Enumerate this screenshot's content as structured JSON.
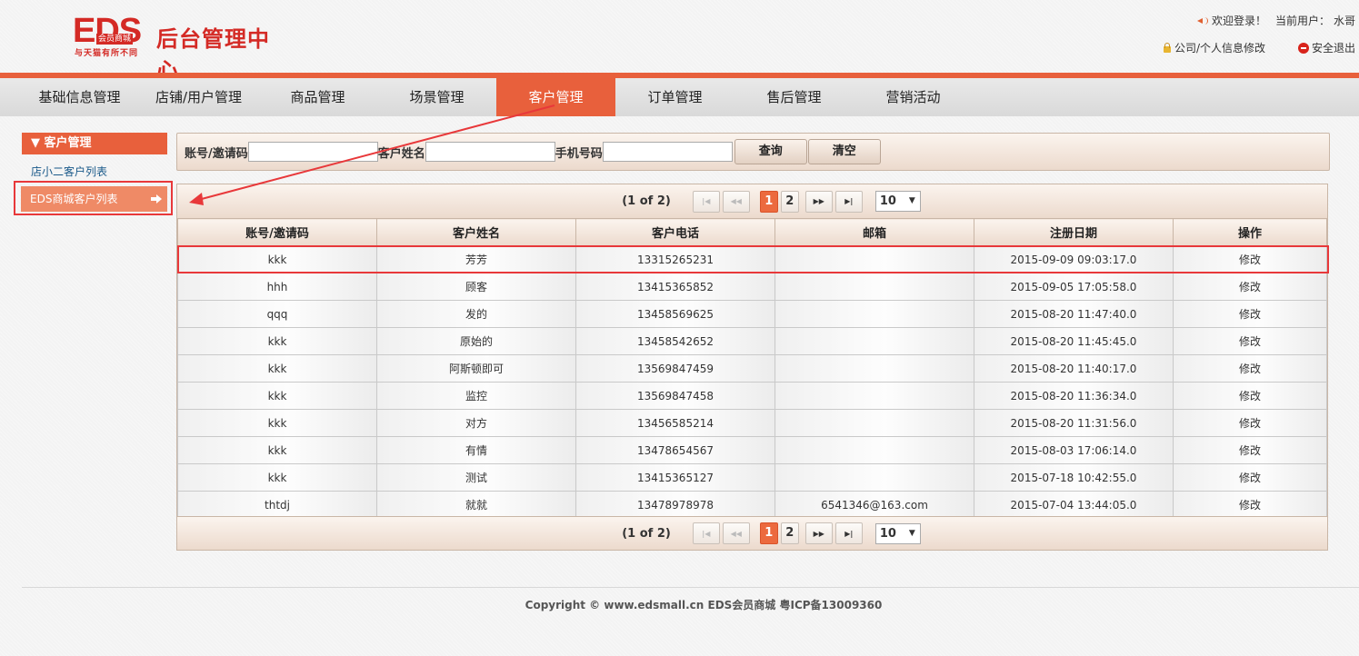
{
  "logo": {
    "eds": "EDS",
    "badge": "会员商城",
    "slogan": "与天猫有所不同",
    "title": "后台管理中心"
  },
  "topbar": {
    "welcome": "欢迎登录！",
    "current_user_label": "当前用户：",
    "current_user": "水哥",
    "profile_link": "公司/个人信息修改",
    "logout_link": "安全退出"
  },
  "nav": {
    "items": [
      {
        "label": "基础信息管理"
      },
      {
        "label": "店铺/用户管理"
      },
      {
        "label": "商品管理"
      },
      {
        "label": "场景管理"
      },
      {
        "label": "客户管理"
      },
      {
        "label": "订单管理"
      },
      {
        "label": "售后管理"
      },
      {
        "label": "营销活动"
      }
    ],
    "active_index": 4
  },
  "sidebar": {
    "header": "▼ 客户管理",
    "link_1": "店小二客户列表",
    "link_active": "EDS商城客户列表"
  },
  "search": {
    "account_label": "账号/邀请码",
    "name_label": "客户姓名",
    "phone_label": "手机号码",
    "account_value": "",
    "name_value": "",
    "phone_value": "",
    "query_btn": "查询",
    "clear_btn": "清空"
  },
  "pager": {
    "info": "(1 of 2)",
    "first": "|◀",
    "prev": "◀◀",
    "pages": [
      "1",
      "2"
    ],
    "current": "1",
    "next": "▶▶",
    "last": "▶|",
    "page_size": "10"
  },
  "table": {
    "columns": [
      "账号/邀请码",
      "客户姓名",
      "客户电话",
      "邮箱",
      "注册日期",
      "操作"
    ],
    "rows": [
      [
        "kkk",
        "芳芳",
        "13315265231",
        "",
        "2015-09-09 09:03:17.0",
        "修改"
      ],
      [
        "hhh",
        "顾客",
        "13415365852",
        "",
        "2015-09-05 17:05:58.0",
        "修改"
      ],
      [
        "qqq",
        "发的",
        "13458569625",
        "",
        "2015-08-20 11:47:40.0",
        "修改"
      ],
      [
        "kkk",
        "原始的",
        "13458542652",
        "",
        "2015-08-20 11:45:45.0",
        "修改"
      ],
      [
        "kkk",
        "阿斯顿即可",
        "13569847459",
        "",
        "2015-08-20 11:40:17.0",
        "修改"
      ],
      [
        "kkk",
        "监控",
        "13569847458",
        "",
        "2015-08-20 11:36:34.0",
        "修改"
      ],
      [
        "kkk",
        "对方",
        "13456585214",
        "",
        "2015-08-20 11:31:56.0",
        "修改"
      ],
      [
        "kkk",
        "有情",
        "13478654567",
        "",
        "2015-08-03 17:06:14.0",
        "修改"
      ],
      [
        "kkk",
        "测试",
        "13415365127",
        "",
        "2015-07-18 10:42:55.0",
        "修改"
      ],
      [
        "thtdj",
        "就就",
        "13478978978",
        "6541346@163.com",
        "2015-07-04 13:44:05.0",
        "修改"
      ]
    ]
  },
  "footer": {
    "copyright": "Copyright © www.edsmall.cn EDS会员商城 粤ICP备13009360"
  },
  "colors": {
    "brand_red": "#d42a25",
    "accent_orange": "#e8603c",
    "annotation_red": "#e8383a"
  }
}
